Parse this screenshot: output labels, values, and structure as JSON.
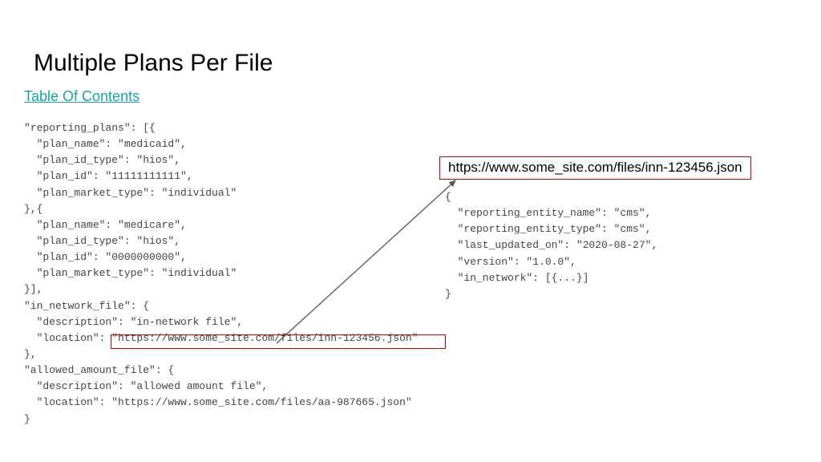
{
  "title": "Multiple Plans Per File",
  "toc": "Table Of Contents",
  "url_box": "https://www.some_site.com/files/inn-123456.json",
  "code_left": "\"reporting_plans\": [{\n  \"plan_name\": \"medicaid\",\n  \"plan_id_type\": \"hios\",\n  \"plan_id\": \"11111111111\",\n  \"plan_market_type\": \"individual\"\n},{\n  \"plan_name\": \"medicare\",\n  \"plan_id_type\": \"hios\",\n  \"plan_id\": \"0000000000\",\n  \"plan_market_type\": \"individual\"\n}],\n\"in_network_file\": {\n  \"description\": \"in-network file\",\n  \"location\": \"https://www.some_site.com/files/inn-123456.json\"\n},\n\"allowed_amount_file\": {\n  \"description\": \"allowed amount file\",\n  \"location\": \"https://www.some_site.com/files/aa-987665.json\"\n}",
  "code_right": "{\n  \"reporting_entity_name\": \"cms\",\n  \"reporting_entity_type\": \"cms\",\n  \"last_updated_on\": \"2020-08-27\",\n  \"version\": \"1.0.0\",\n  \"in_network\": [{...}]\n}"
}
